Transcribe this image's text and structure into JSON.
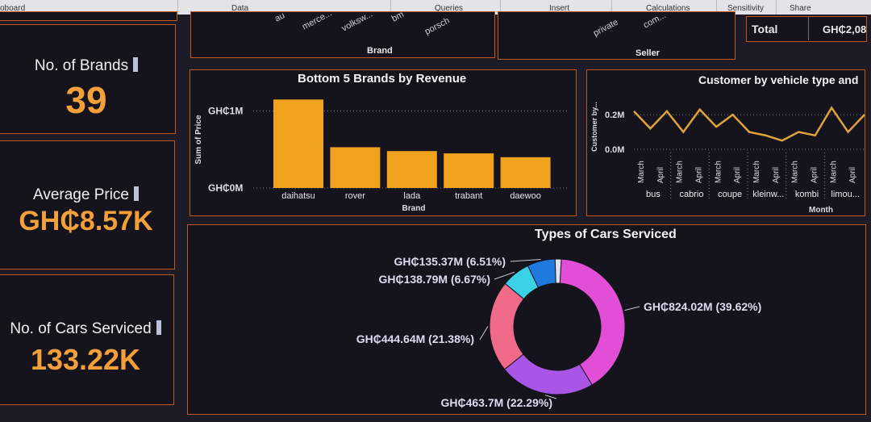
{
  "ribbon": {
    "items": [
      "oboard",
      "Data",
      "Queries",
      "Insert",
      "Calculations",
      "Sensitivity",
      "Share"
    ]
  },
  "kpis": {
    "brands": {
      "title": "No. of Brands",
      "value": "39"
    },
    "avg_price": {
      "title": "Average Price",
      "value": "GH₵8.57K"
    },
    "cars": {
      "title": "No. of Cars Serviced",
      "value": "133.22K"
    }
  },
  "top_slicer": {
    "brand_items": [
      "au",
      "merce...",
      "volksw...",
      "bm",
      "porsch"
    ],
    "brand_label": "Brand",
    "seller_items": [
      "private",
      "com..."
    ],
    "seller_label": "Seller"
  },
  "total": {
    "label": "Total",
    "value": "GH₵2,08"
  },
  "colors": {
    "accent_border": "#c2571c",
    "bar": "#f0a21e",
    "line": "#e0a23a",
    "donut": [
      "#e24fd6",
      "#a955e6",
      "#f06a8a",
      "#3ad0e6",
      "#1f7ae0",
      "#dfe3ee"
    ]
  },
  "chart_data": [
    {
      "type": "bar",
      "title": "Bottom 5 Brands by Revenue",
      "xlabel": "Brand",
      "ylabel": "Sum of Price",
      "categories": [
        "daihatsu",
        "rover",
        "lada",
        "trabant",
        "daewoo"
      ],
      "values": [
        1.15,
        0.53,
        0.48,
        0.45,
        0.4
      ],
      "yticks": [
        "GH₵0M",
        "GH₵1M"
      ],
      "ylim": [
        0,
        1.3
      ],
      "grid": true
    },
    {
      "type": "line",
      "title": "Customer by vehicle type and",
      "xlabel": "Month",
      "ylabel": "Customer by...",
      "yticks": [
        "0.0M",
        "0.2M"
      ],
      "ylim": [
        0,
        0.28
      ],
      "groups": [
        "bus",
        "cabrio",
        "coupe",
        "kleinw...",
        "kombi",
        "limou..."
      ],
      "months": [
        "March",
        "April"
      ],
      "values": [
        0.22,
        0.12,
        0.22,
        0.1,
        0.23,
        0.13,
        0.2,
        0.1,
        0.08,
        0.05,
        0.1,
        0.08,
        0.24,
        0.1,
        0.2
      ],
      "grid": true
    },
    {
      "type": "pie",
      "title": "Types of Cars Serviced",
      "labels": [
        "GH₵824.02M (39.62%)",
        "GH₵463.7M (22.29%)",
        "GH₵444.64M (21.38%)",
        "GH₵138.79M (6.67%)",
        "GH₵135.37M (6.51%)",
        ""
      ],
      "values": [
        824.02,
        463.7,
        444.64,
        138.79,
        135.37,
        30
      ],
      "percent": [
        39.62,
        22.29,
        21.38,
        6.67,
        6.51,
        1.5
      ],
      "donut": true
    }
  ]
}
